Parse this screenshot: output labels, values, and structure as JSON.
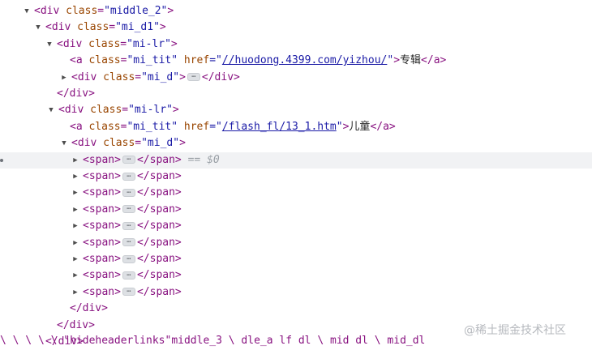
{
  "elements_tree": {
    "rows": [
      {
        "tri": "▼",
        "open": "<div",
        "attr": "class",
        "val": "\"middle_2\"",
        "close": ">"
      },
      {
        "tri": "▼",
        "open": "<div",
        "attr": "class",
        "val": "\"mi_d1\"",
        "close": ">"
      },
      {
        "tri": "▼",
        "open": "<div",
        "attr": "class",
        "val": "\"mi-lr\"",
        "close": ">"
      },
      {
        "open": "<a",
        "attr": "class",
        "val": "\"mi_tit\"",
        "attr2": "href",
        "q1": "=\"",
        "link": "//huodong.4399.com/yizhou/",
        "q2": "\"",
        "close": ">",
        "text": "专辑",
        "end": "</a>"
      },
      {
        "tri": "▶",
        "open": "<div",
        "attr": "class",
        "val": "\"mi_d\"",
        "close": ">",
        "end": "</div>"
      },
      {
        "end": "</div>"
      },
      {
        "tri": "▼",
        "open": "<div",
        "attr": "class",
        "val": "\"mi-lr\"",
        "close": ">"
      },
      {
        "open": "<a",
        "attr": "class",
        "val": "\"mi_tit\"",
        "attr2": "href",
        "q1": "=\"",
        "link": "/flash_fl/13_1.htm",
        "q2": "\"",
        "close": ">",
        "text": "儿童",
        "end": "</a>"
      },
      {
        "tri": "▼",
        "open": "<div",
        "attr": "class",
        "val": "\"mi_d\"",
        "close": ">"
      },
      {
        "tri": "▶",
        "open": "<span>",
        "end": "</span>",
        "eq": "== $0"
      },
      {
        "tri": "▶",
        "open": "<span>",
        "end": "</span>"
      },
      {
        "tri": "▶",
        "open": "<span>",
        "end": "</span>"
      },
      {
        "tri": "▶",
        "open": "<span>",
        "end": "</span>"
      },
      {
        "tri": "▶",
        "open": "<span>",
        "end": "</span>"
      },
      {
        "tri": "▶",
        "open": "<span>",
        "end": "</span>"
      },
      {
        "tri": "▶",
        "open": "<span>",
        "end": "</span>"
      },
      {
        "tri": "▶",
        "open": "<span>",
        "end": "</span>"
      },
      {
        "tri": "▶",
        "open": "<span>",
        "end": "</span>"
      },
      {
        "end": "</div>"
      },
      {
        "end": "</div>"
      },
      {
        "end": "</div>"
      }
    ],
    "ellipsis_glyph": "⋯",
    "cutoff_text": "\\  \\  \\   \\   \\  \"hideheaderlinks\"middle_3  \\ dle_a  lf  dl  \\ mid dl  \\ mid_dl"
  },
  "watermark": "@稀土掘金技术社区"
}
